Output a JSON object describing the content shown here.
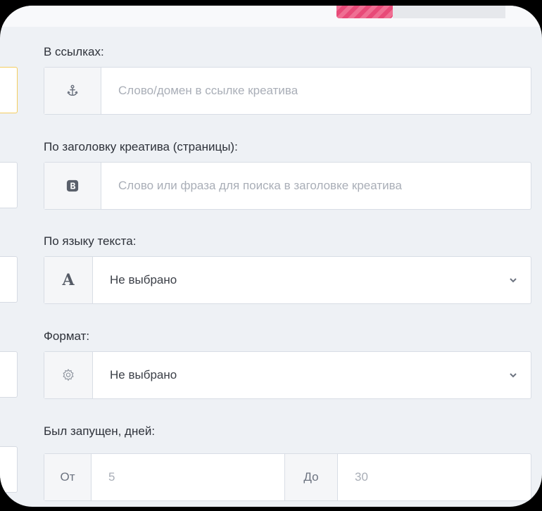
{
  "filters": {
    "links": {
      "label": "В ссылках:",
      "icon": "anchor-icon",
      "placeholder": "Слово/домен в ссылке креатива"
    },
    "title": {
      "label": "По заголовку креатива (страницы):",
      "icon": "bold-b-icon",
      "placeholder": "Слово или фраза для поиска в заголовке креатива"
    },
    "language": {
      "label": "По языку текста:",
      "icon_text": "A",
      "value": "Не выбрано"
    },
    "format": {
      "label": "Формат:",
      "icon": "gear-icon",
      "value": "Не выбрано"
    },
    "launched": {
      "label": "Был запущен, дней:",
      "from_label": "От",
      "from_value": "5",
      "to_label": "До",
      "to_value": "30"
    }
  },
  "colors": {
    "accent_pink": "#e84a78",
    "stub_highlight": "#f4cd60"
  }
}
